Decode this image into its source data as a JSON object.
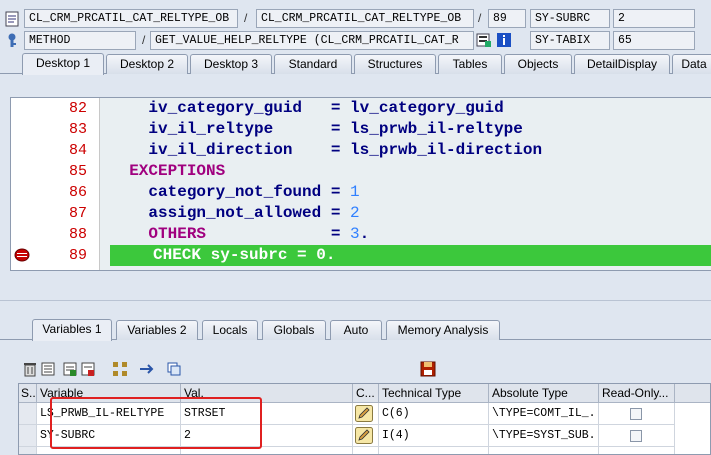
{
  "info": {
    "row1": {
      "program": "CL_CRM_PRCATIL_CAT_RELTYPE_OB",
      "include": "CL_CRM_PRCATIL_CAT_RELTYPE_OB",
      "line": "89",
      "sysfield": "SY-SUBRC",
      "sysvalue": "2"
    },
    "row2": {
      "type": "METHOD",
      "event": "GET_VALUE_HELP_RELTYPE (CL_CRM_PRCATIL_CAT_R",
      "sysfield": "SY-TABIX",
      "sysvalue": "65"
    }
  },
  "desktop_tabs": [
    "Desktop 1",
    "Desktop 2",
    "Desktop 3",
    "Standard",
    "Structures",
    "Tables",
    "Objects",
    "DetailDisplay",
    "Data"
  ],
  "code": [
    {
      "num": "82",
      "parts": [
        {
          "t": "    iv_category_guid   = lv_category_guid",
          "c": ""
        }
      ]
    },
    {
      "num": "83",
      "parts": [
        {
          "t": "    iv_il_reltype      = ls_prwb_il-reltype",
          "c": ""
        }
      ]
    },
    {
      "num": "84",
      "parts": [
        {
          "t": "    iv_il_direction    = ls_prwb_il-direction",
          "c": ""
        }
      ]
    },
    {
      "num": "85",
      "parts": [
        {
          "t": "  EXCEPTIONS",
          "c": "kw"
        }
      ]
    },
    {
      "num": "86",
      "parts": [
        {
          "t": "    category_not_found = ",
          "c": ""
        },
        {
          "t": "1",
          "c": "num"
        }
      ]
    },
    {
      "num": "87",
      "parts": [
        {
          "t": "    assign_not_allowed = ",
          "c": ""
        },
        {
          "t": "2",
          "c": "num"
        }
      ]
    },
    {
      "num": "88",
      "parts": [
        {
          "t": "    OTHERS",
          "c": "kw"
        },
        {
          "t": "             = ",
          "c": ""
        },
        {
          "t": "3",
          "c": "num"
        },
        {
          "t": ".",
          "c": ""
        }
      ]
    },
    {
      "num": "89",
      "parts": [
        {
          "t": "CHECK sy-subrc = 0.",
          "c": ""
        }
      ],
      "current": true
    }
  ],
  "var_tabs": [
    "Variables 1",
    "Variables 2",
    "Locals",
    "Globals",
    "Auto",
    "Memory Analysis"
  ],
  "table": {
    "headers": [
      "S...",
      "Variable",
      "Val.",
      "C...",
      "Technical Type",
      "Absolute Type",
      "Read-Only..."
    ],
    "rows": [
      {
        "variable": "LS_PRWB_IL-RELTYPE",
        "value": "STRSET",
        "tech": "C(6)",
        "abs": "\\TYPE=COMT_IL_..."
      },
      {
        "variable": "SY-SUBRC",
        "value": "2",
        "tech": "I(4)",
        "abs": "\\TYPE=SYST_SUB..."
      }
    ]
  },
  "colors": {
    "current_line": "#3cc83c",
    "keyword": "#a0007f",
    "line_number": "#cc0000",
    "highlight_box": "#e02020"
  }
}
